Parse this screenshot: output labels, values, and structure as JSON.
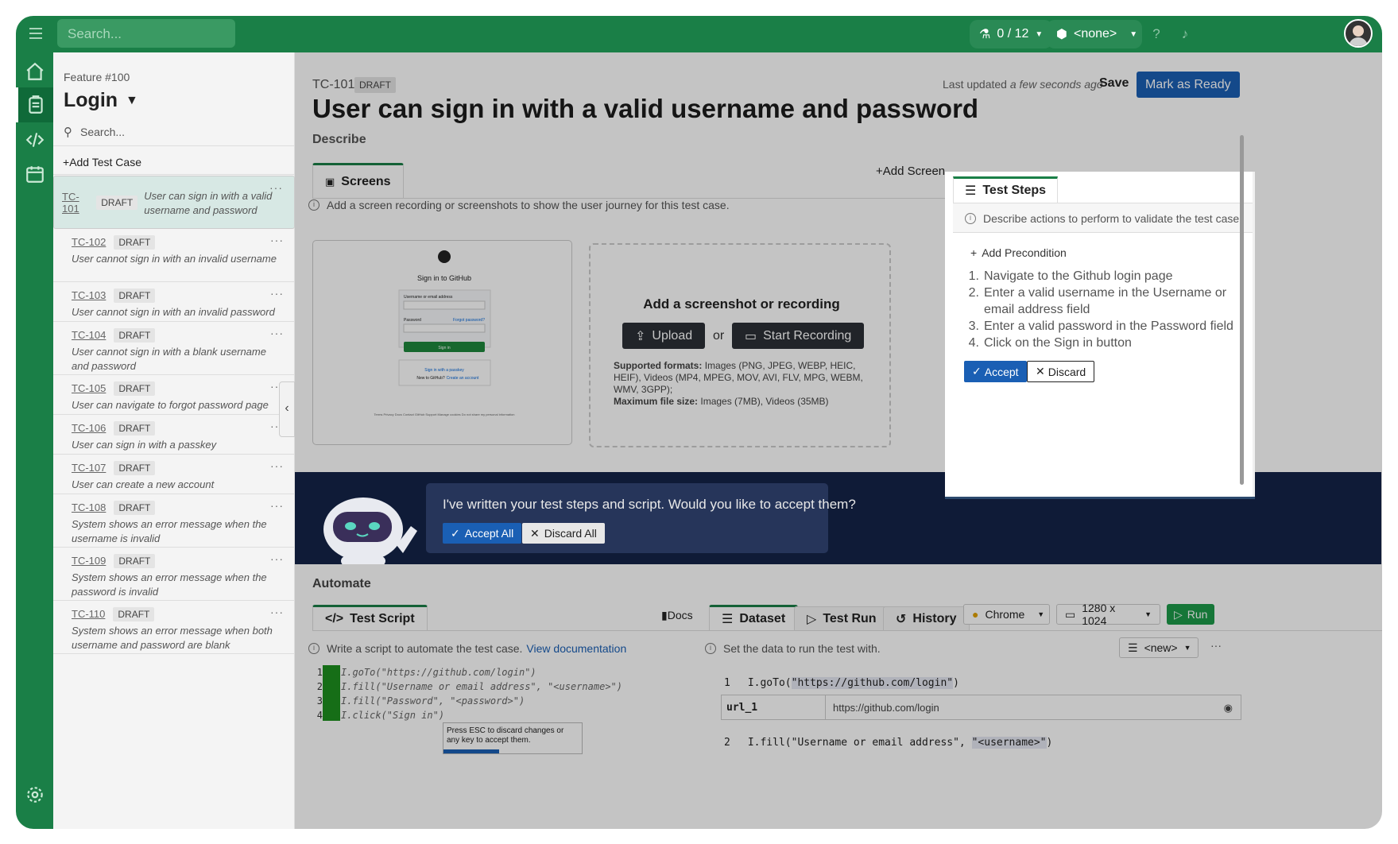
{
  "topbar": {
    "search_placeholder": "Search...",
    "runs_count": "0 / 12",
    "env_selector": "<none>"
  },
  "feature": {
    "label": "Feature #100",
    "title": "Login",
    "search_placeholder": "Search...",
    "add_test_case": "Add Test Case",
    "test_cases": [
      {
        "id": "TC-101",
        "status": "DRAFT",
        "title": "User can sign in with a valid username and password"
      },
      {
        "id": "TC-102",
        "status": "DRAFT",
        "title": "User cannot sign in with an invalid username"
      },
      {
        "id": "TC-103",
        "status": "DRAFT",
        "title": "User cannot sign in with an invalid password"
      },
      {
        "id": "TC-104",
        "status": "DRAFT",
        "title": "User cannot sign in with a blank username and password"
      },
      {
        "id": "TC-105",
        "status": "DRAFT",
        "title": "User can navigate to forgot password page"
      },
      {
        "id": "TC-106",
        "status": "DRAFT",
        "title": "User can sign in with a passkey"
      },
      {
        "id": "TC-107",
        "status": "DRAFT",
        "title": "User can create a new account"
      },
      {
        "id": "TC-108",
        "status": "DRAFT",
        "title": "System shows an error message when the username is invalid"
      },
      {
        "id": "TC-109",
        "status": "DRAFT",
        "title": "System shows an error message when the password is invalid"
      },
      {
        "id": "TC-110",
        "status": "DRAFT",
        "title": "System shows an error message when both username and password are blank"
      }
    ]
  },
  "header": {
    "id": "TC-101",
    "status": "DRAFT",
    "last_updated_prefix": "Last updated",
    "last_updated_value": "a few seconds ago",
    "save": "Save",
    "mark_ready": "Mark as Ready",
    "title": "User can sign in with a valid username and password"
  },
  "describe": {
    "heading": "Describe",
    "screens_tab": "Screens",
    "add_screen": "Add Screen",
    "info": "Add a screen recording or screenshots to show the user journey for this test case.",
    "thumb": {
      "title": "Sign in to GitHub",
      "username_label": "Username or email address",
      "password_label": "Password",
      "forgot": "Forgot password?",
      "sign_in": "Sign in",
      "passkey": "Sign in with a passkey",
      "new_to": "New to GitHub?",
      "create": "Create an account",
      "footer": "Terms   Privacy   Docs   Contact GitHub Support   Manage cookies   Do not share my personal information"
    },
    "drop": {
      "title": "Add a screenshot or recording",
      "upload": "Upload",
      "or": "or",
      "start_recording": "Start Recording",
      "formats_label": "Supported formats:",
      "formats_value": "Images (PNG, JPEG, WEBP, HEIC, HEIF), Videos (MP4, MPEG, MOV, AVI, FLV, MPG, WEBM, WMV, 3GPP);",
      "max_label": "Maximum file size:",
      "max_value": "Images (7MB), Videos (35MB)"
    }
  },
  "steps": {
    "tab": "Test Steps",
    "info": "Describe actions to perform to validate the test case.",
    "add_precondition": "Add Precondition",
    "items": [
      "Navigate to the Github login page",
      "Enter a valid username in the Username or email address field",
      "Enter a valid password in the Password field",
      "Click on the Sign in button"
    ],
    "accept": "Accept",
    "discard": "Discard"
  },
  "banner": {
    "text": "I've written your test steps and script. Would you like to accept them?",
    "accept_all": "Accept All",
    "discard_all": "Discard All"
  },
  "automate": {
    "heading": "Automate",
    "script_tab": "Test Script",
    "docs": "Docs",
    "info": "Write a script to automate the test case.",
    "info_link": "View documentation",
    "code": [
      "I.goTo(\"https://github.com/login\")",
      "I.fill(\"Username or email address\", \"<username>\")",
      "I.fill(\"Password\", \"<password>\")",
      "I.click(\"Sign in\")"
    ],
    "tooltip": "Press ESC to discard changes or any key to accept them."
  },
  "dataset": {
    "tabs": [
      "Dataset",
      "Test Run",
      "History"
    ],
    "browser": "Chrome",
    "resolution": "1280 x 1024",
    "run": "Run",
    "info": "Set the data to run the test with.",
    "dataset_select": "<new>",
    "line1_num": "1",
    "line1_prefix": "I.goTo(",
    "line1_arg": "\"https://github.com/login\"",
    "line1_suffix": ")",
    "url_key": "url_1",
    "url_value": "https://github.com/login",
    "line2_num": "2",
    "line2_prefix": "I.fill(\"Username or email address\", ",
    "line2_arg": "\"<username>\"",
    "line2_suffix": ")"
  }
}
